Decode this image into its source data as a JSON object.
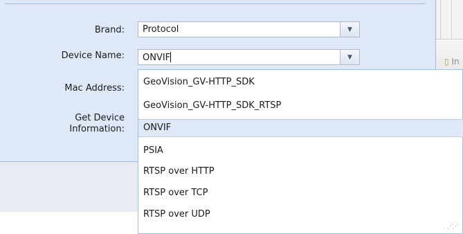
{
  "form": {
    "brand": {
      "label": "Brand:",
      "value": "Protocol"
    },
    "device_name": {
      "label": "Device Name:",
      "value": "ONVIF"
    },
    "mac_address": {
      "label": "Mac Address:"
    },
    "get_device_info": {
      "label_line1": "Get Device",
      "label_line2": "Information:"
    }
  },
  "dropdown": {
    "options": [
      "GeoVision_GV-HTTP_SDK",
      "GeoVision_GV-HTTP_SDK_RTSP",
      "ONVIF",
      "PSIA",
      "RTSP over HTTP",
      "RTSP over TCP",
      "RTSP over UDP"
    ],
    "selected": "ONVIF"
  },
  "toolbar": {
    "partial_label": "In"
  },
  "icons": {
    "combo_trigger": "chevron-down-icon",
    "toolbar": "document-icon",
    "resize": "resize-grip-icon"
  },
  "colors": {
    "panel_bg": "#dfe8f6",
    "panel_border": "#99bbe8",
    "selected_row": "#dfe8f6"
  }
}
